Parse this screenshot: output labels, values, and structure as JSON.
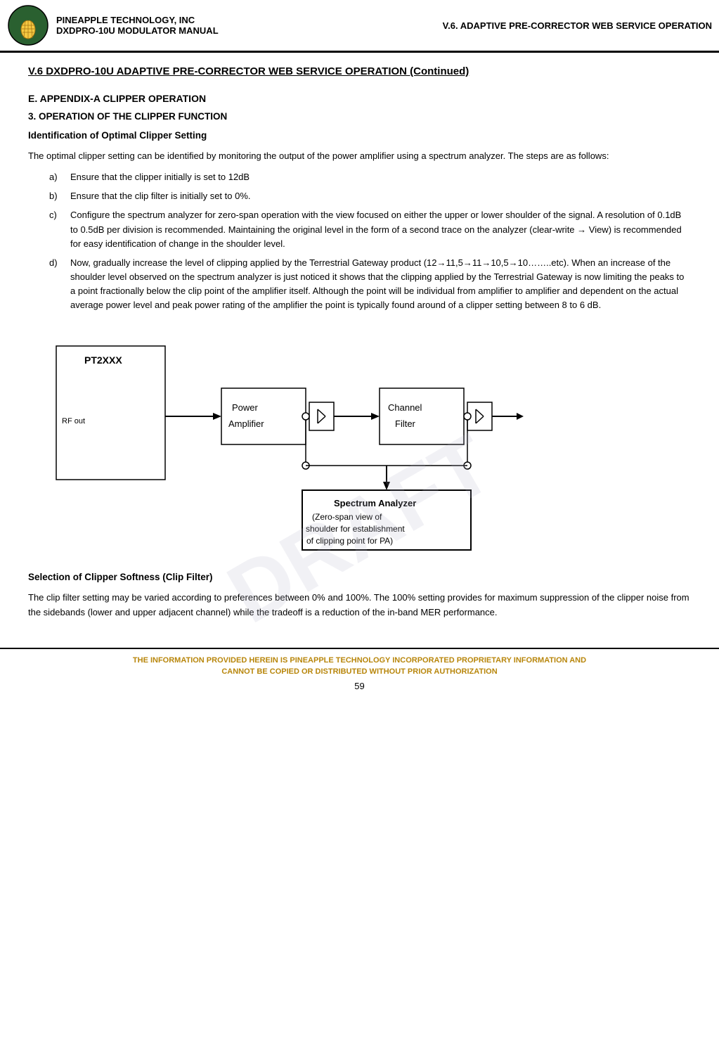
{
  "header": {
    "company": "PINEAPPLE TECHNOLOGY, INC",
    "manual": "DXDPRO-10U MODULATOR MANUAL",
    "section": "V.6. ADAPTIVE PRE-CORRECTOR WEB SERVICE OPERATION"
  },
  "page_title": "V.6  DXDPRO-10U ADAPTIVE PRE-CORRECTOR WEB SERVICE OPERATION (Continued)",
  "section_e": {
    "heading": "E.   APPENDIX-A   CLIPPER OPERATION",
    "sub1": "3. OPERATION OF THE CLIPPER FUNCTION",
    "sub2": "Identification of Optimal Clipper Setting"
  },
  "body": {
    "intro": "The optimal clipper setting can be identified by monitoring the output of the power amplifier using a spectrum analyzer. The steps are as follows:",
    "list_items": [
      {
        "label": "a)",
        "text": "Ensure that the clipper initially is set to 12dB"
      },
      {
        "label": "b)",
        "text": "Ensure that the clip filter is initially set to 0%."
      },
      {
        "label": "c)",
        "text": "Configure the spectrum analyzer for zero-span operation with the view focused on either the upper or lower shoulder of the signal. A resolution of 0.1dB to 0.5dB per division is recommended. Maintaining the original level in the form of a second trace on the analyzer (clear-write → View) is recommended for easy identification of change in the shoulder level."
      },
      {
        "label": "d)",
        "text": "Now, gradually increase the level of clipping applied by the Terrestrial Gateway product (12→11,5→11→10,5→10……..etc). When an increase of the shoulder level observed on the spectrum analyzer is just noticed it shows that the clipping applied by the Terrestrial Gateway is now limiting the peaks to a point fractionally below the clip point of the amplifier itself. Although the point will be individual from amplifier to amplifier and dependent on the actual average power level and peak power rating of the amplifier the point is typically found around of a clipper setting between 8 to 6 dB."
      }
    ]
  },
  "diagram": {
    "pt2xxx_label": "PT2XXX",
    "rf_out_label": "RF out",
    "power_amp_label1": "Power",
    "power_amp_label2": "Amplifier",
    "channel_filter_label1": "Channel",
    "channel_filter_label2": "Filter",
    "spectrum_analyzer_title": "Spectrum Analyzer",
    "spectrum_analyzer_desc": "(Zero-span view of shoulder for establishment of clipping point for PA)"
  },
  "section_softness": {
    "heading": "Selection of Clipper Softness (Clip Filter)",
    "text": "The clip filter setting may be varied according to preferences between 0% and 100%. The 100% setting provides for maximum suppression of the clipper noise from the sidebands (lower and upper adjacent channel) while the tradeoff is a reduction of the in-band MER performance."
  },
  "footer": {
    "line1": "THE INFORMATION PROVIDED HEREIN IS PINEAPPLE TECHNOLOGY INCORPORATED PROPRIETARY INFORMATION AND",
    "line2": "CANNOT BE COPIED OR DISTRIBUTED WITHOUT PRIOR AUTHORIZATION",
    "page": "59"
  }
}
